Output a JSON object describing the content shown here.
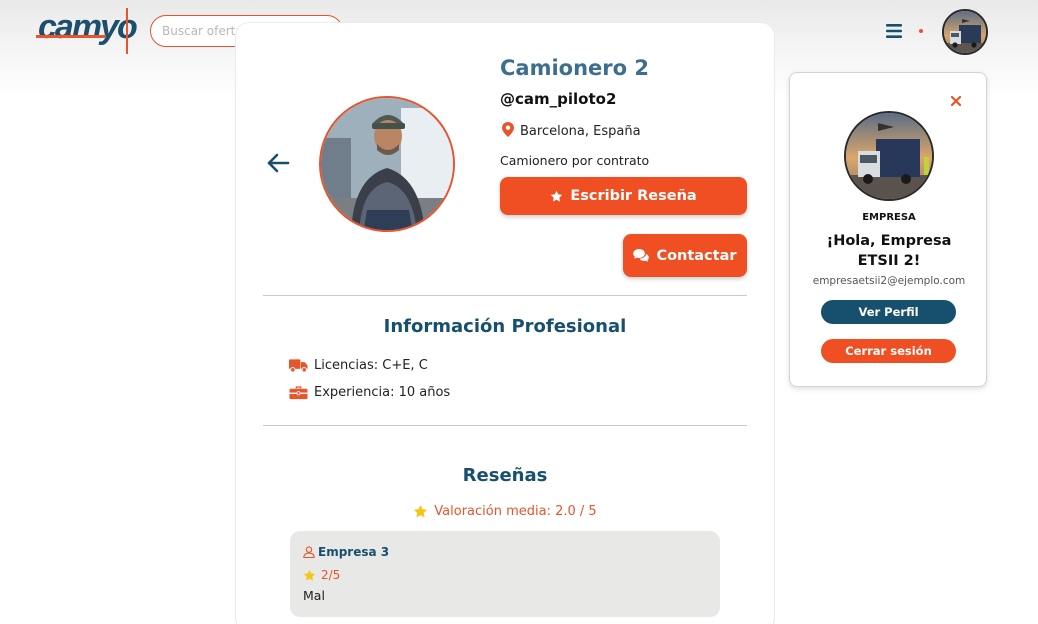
{
  "header": {
    "logo_text": "camyo",
    "search_placeholder": "Buscar ofertas...",
    "menu_icon": "hamburger-menu-icon",
    "search_icon": "search-icon"
  },
  "profile": {
    "name": "Camionero 2",
    "handle": "@cam_piloto2",
    "location": "Barcelona, España",
    "role": "Camionero por contrato",
    "write_review_label": "Escribir Reseña",
    "contact_label": "Contactar"
  },
  "professional_info": {
    "title": "Información Profesional",
    "licenses": "Licencias: C+E, C",
    "experience": "Experiencia: 10 años"
  },
  "reviews": {
    "title": "Reseñas",
    "average": "Valoración media: 2.0 / 5",
    "items": [
      {
        "author": "Empresa 3",
        "rating": "2/5",
        "text": "Mal"
      }
    ]
  },
  "user_panel": {
    "role": "EMPRESA",
    "greeting": "¡Hola, Empresa ETSII 2!",
    "email": "empresaetsii2@ejemplo.com",
    "view_profile_label": "Ver Perfil",
    "logout_label": "Cerrar sesión"
  },
  "colors": {
    "accent": "#f04f23",
    "primary": "#17506f",
    "title_blue": "#3b6e8f",
    "star": "#f5c518"
  }
}
